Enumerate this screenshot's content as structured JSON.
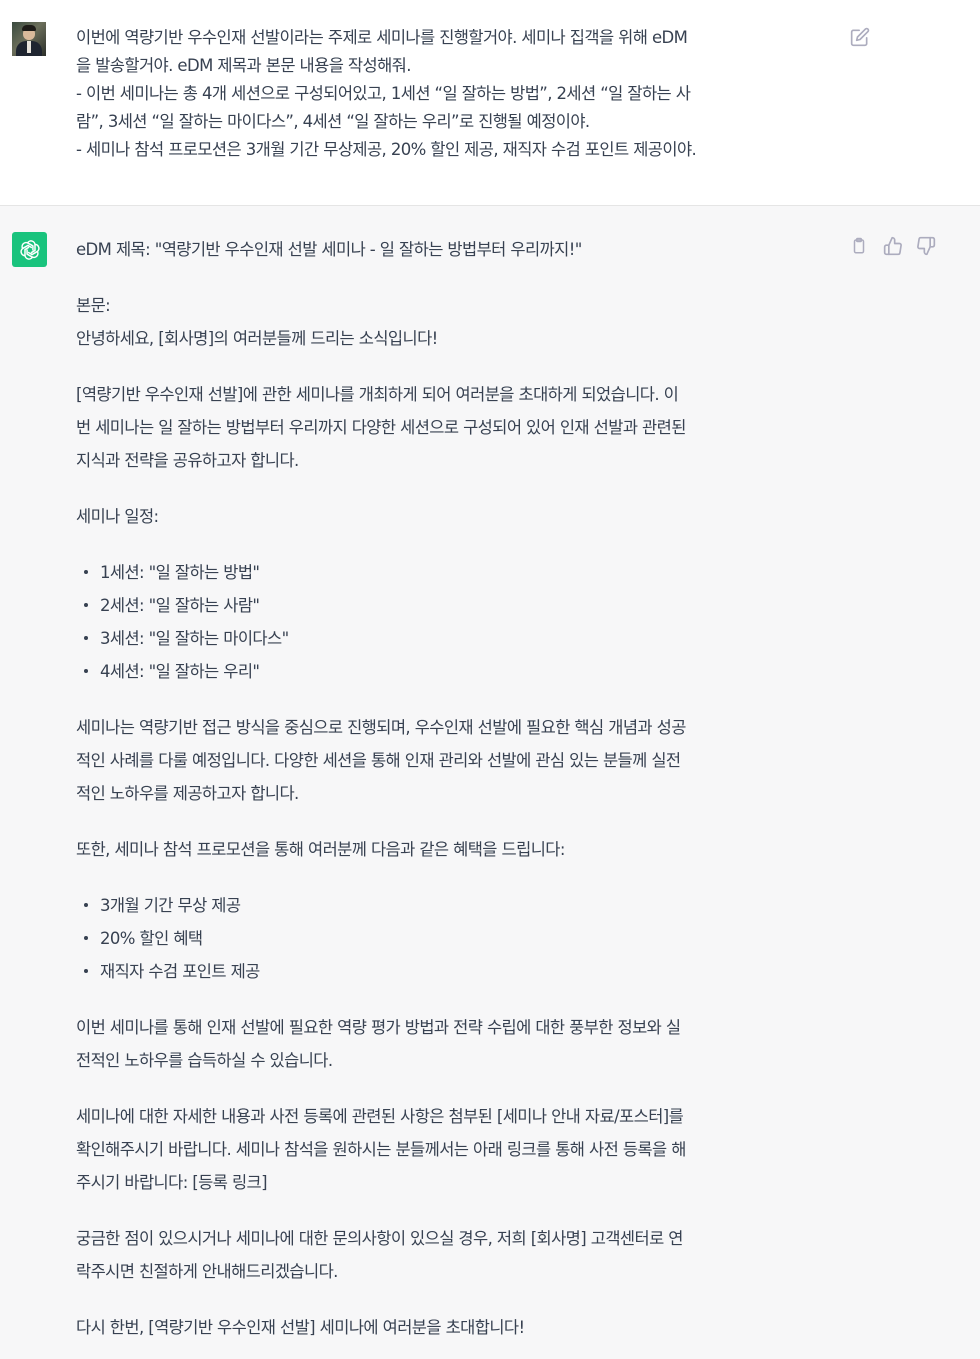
{
  "user_message": {
    "lines": [
      "이번에 역량기반 우수인재 선발이라는 주제로 세미나를 진행할거야. 세미나 집객을 위해 eDM",
      "을 발송할거야. eDM 제목과 본문 내용을 작성해줘.",
      "- 이번 세미나는 총 4개 세션으로 구성되어있고, 1세션 “일 잘하는 방법”, 2세션 “일 잘하는 사",
      "람”, 3세션 “일 잘하는 마이다스”, 4세션 “일 잘하는 우리”로 진행될 예정이야.",
      "- 세미나 참석 프로모션은 3개월 기간 무상제공, 20% 할인 제공, 재직자 수검 포인트 제공이야."
    ]
  },
  "assistant_message": {
    "subject": "eDM 제목: \"역량기반 우수인재 선발 세미나 - 일 잘하는 방법부터 우리까지!\"",
    "body_label": "본문:",
    "greeting": "안녕하세요, [회사명]의 여러분들께 드리는 소식입니다!",
    "intro_lines": [
      "[역량기반 우수인재 선발]에 관한 세미나를 개최하게 되어 여러분을 초대하게 되었습니다. 이",
      "번 세미나는 일 잘하는 방법부터 우리까지 다양한 세션으로 구성되어 있어 인재 선발과 관련된",
      "지식과 전략을 공유하고자 합니다."
    ],
    "schedule_label": "세미나 일정:",
    "sessions": [
      "1세션: \"일 잘하는 방법\"",
      "2세션: \"일 잘하는 사람\"",
      "3세션: \"일 잘하는 마이다스\"",
      "4세션: \"일 잘하는 우리\""
    ],
    "description_lines": [
      "세미나는 역량기반 접근 방식을 중심으로 진행되며, 우수인재 선발에 필요한 핵심 개념과 성공",
      "적인 사례를 다룰 예정입니다. 다양한 세션을 통해 인재 관리와 선발에 관심 있는 분들께 실전",
      "적인 노하우를 제공하고자 합니다."
    ],
    "promo_label": "또한, 세미나 참석 프로모션을 통해 여러분께 다음과 같은 혜택을 드립니다:",
    "benefits": [
      "3개월 기간 무상 제공",
      "20% 할인 혜택",
      "재직자 수검 포인트 제공"
    ],
    "value_lines": [
      "이번 세미나를 통해 인재 선발에 필요한 역량 평가 방법과 전략 수립에 대한 풍부한 정보와 실",
      "전적인 노하우를 습득하실 수 있습니다."
    ],
    "registration_lines": [
      "세미나에 대한 자세한 내용과 사전 등록에 관련된 사항은 첨부된 [세미나 안내 자료/포스터]를",
      "확인해주시기 바랍니다. 세미나 참석을 원하시는 분들께서는 아래 링크를 통해 사전 등록을 해",
      "주시기 바랍니다: [등록 링크]"
    ],
    "contact_lines": [
      "궁금한 점이 있으시거나 세미나에 대한 문의사항이 있으실 경우, 저희 [회사명] 고객센터로 연",
      "락주시면 친절하게 안내해드리겠습니다."
    ],
    "closing": "다시 한번, [역량기반 우수인재 선발] 세미나에 여러분을 초대합니다!"
  },
  "icons": {
    "edit": "edit-icon",
    "copy": "clipboard-icon",
    "thumbs_up": "thumbs-up-icon",
    "thumbs_down": "thumbs-down-icon",
    "bot_logo": "openai-logo-icon"
  },
  "colors": {
    "bot_avatar": "#19c37d",
    "assistant_bg": "#f7f7f8",
    "user_bg": "#ffffff",
    "text": "#374151",
    "icon": "#acacbe"
  }
}
